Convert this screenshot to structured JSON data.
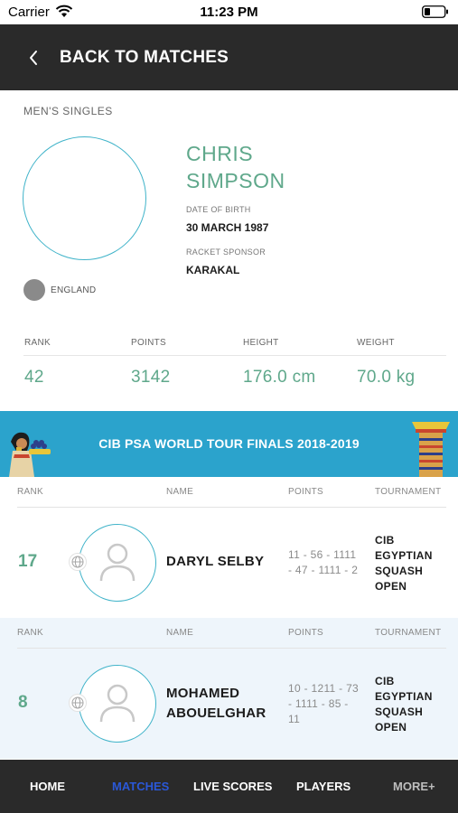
{
  "status_bar": {
    "carrier": "Carrier",
    "time": "11:23 PM"
  },
  "header": {
    "back_label": "BACK TO MATCHES"
  },
  "player": {
    "category": "MEN'S SINGLES",
    "first_name": "CHRIS",
    "last_name": "SIMPSON",
    "dob_label": "DATE OF BIRTH",
    "dob": "30 MARCH 1987",
    "sponsor_label": "RACKET SPONSOR",
    "sponsor": "KARAKAL",
    "country": "ENGLAND"
  },
  "stats": {
    "rank_label": "RANK",
    "rank": "42",
    "points_label": "POINTS",
    "points": "3142",
    "height_label": "HEIGHT",
    "height": "176.0 cm",
    "weight_label": "WEIGHT",
    "weight": "70.0 kg"
  },
  "banner": {
    "title": "CIB PSA WORLD TOUR FINALS 2018-2019"
  },
  "rankings": {
    "columns": {
      "rank": "RANK",
      "name": "NAME",
      "points": "POINTS",
      "tournament": "TOURNAMENT"
    },
    "rows": [
      {
        "rank": "17",
        "name_lines": [
          "DARYL SELBY"
        ],
        "points_lines": [
          "11 - 56 - 1111",
          "- 47 - 1111 - 2"
        ],
        "tournament_lines": [
          "CIB",
          "EGYPTIAN",
          "SQUASH",
          "OPEN"
        ]
      },
      {
        "rank": "8",
        "name_lines": [
          "MOHAMED",
          "ABOUELGHAR"
        ],
        "points_lines": [
          "10 - 1211 - 73",
          "- 1111 - 85 -",
          "11"
        ],
        "tournament_lines": [
          "CIB",
          "EGYPTIAN",
          "SQUASH",
          "OPEN"
        ]
      }
    ]
  },
  "nav": {
    "items": [
      "HOME",
      "MATCHES",
      "LIVE SCORES",
      "PLAYERS",
      "MORE+"
    ],
    "active": "MATCHES"
  },
  "colors": {
    "header_bg": "#2a2a2a",
    "accent_green": "#5fa88b",
    "accent_blue": "#3fb3c9",
    "banner_bg": "#2ba3cc",
    "nav_active": "#2a58d8"
  }
}
